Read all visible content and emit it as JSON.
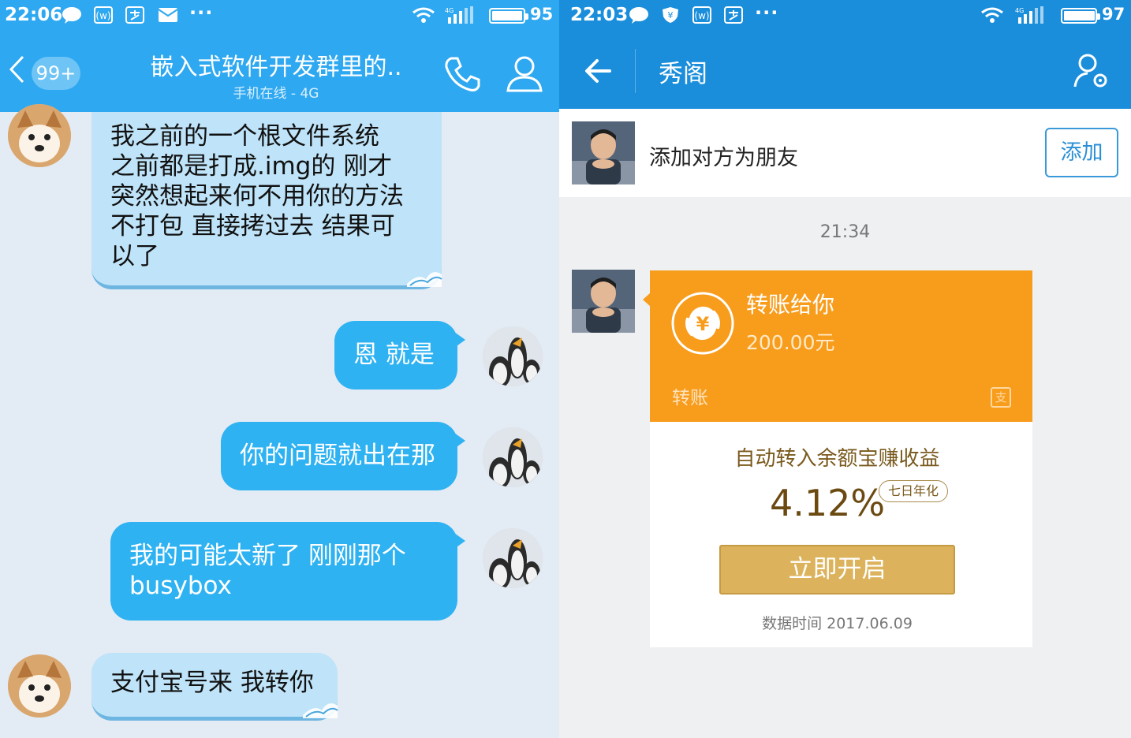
{
  "left": {
    "status": {
      "time": "22:06",
      "battery": "95"
    },
    "header": {
      "badge": "99+",
      "title": "嵌入式软件开发群里的..",
      "subtitle": "手机在线 - 4G"
    },
    "messages": [
      {
        "side": "in",
        "text": "我之前的一个根文件系统\n之前都是打成.img的   刚才\n突然想起来何不用你的方法\n不打包 直接拷过去  结果可\n以了"
      },
      {
        "side": "out",
        "text": "恩 就是"
      },
      {
        "side": "out",
        "text": "你的问题就出在那"
      },
      {
        "side": "out",
        "text": "我的可能太新了 刚刚那个\nbusybox"
      },
      {
        "side": "in",
        "text": "支付宝号来 我转你"
      }
    ]
  },
  "right": {
    "status": {
      "time": "22:03",
      "battery": "97"
    },
    "header": {
      "title": "秀阁"
    },
    "add_friend": {
      "text": "添加对方为朋友",
      "button": "添加"
    },
    "timestamp": "21:34",
    "transfer": {
      "title": "转账给你",
      "amount": "200.00元",
      "label": "转账",
      "promo": "自动转入余额宝赚收益",
      "rate": "4.12%",
      "rate_badge": "七日年化",
      "button": "立即开启",
      "data_time": "数据时间 2017.06.09"
    },
    "colors": {
      "header": "#1a8edb",
      "transfer": "#f89c1c",
      "gold_button": "#dcb35c"
    }
  },
  "colors": {
    "qq_header": "#2ea8f0",
    "bubble_out": "#2eb2f2",
    "bubble_in": "#bfe3f8"
  }
}
